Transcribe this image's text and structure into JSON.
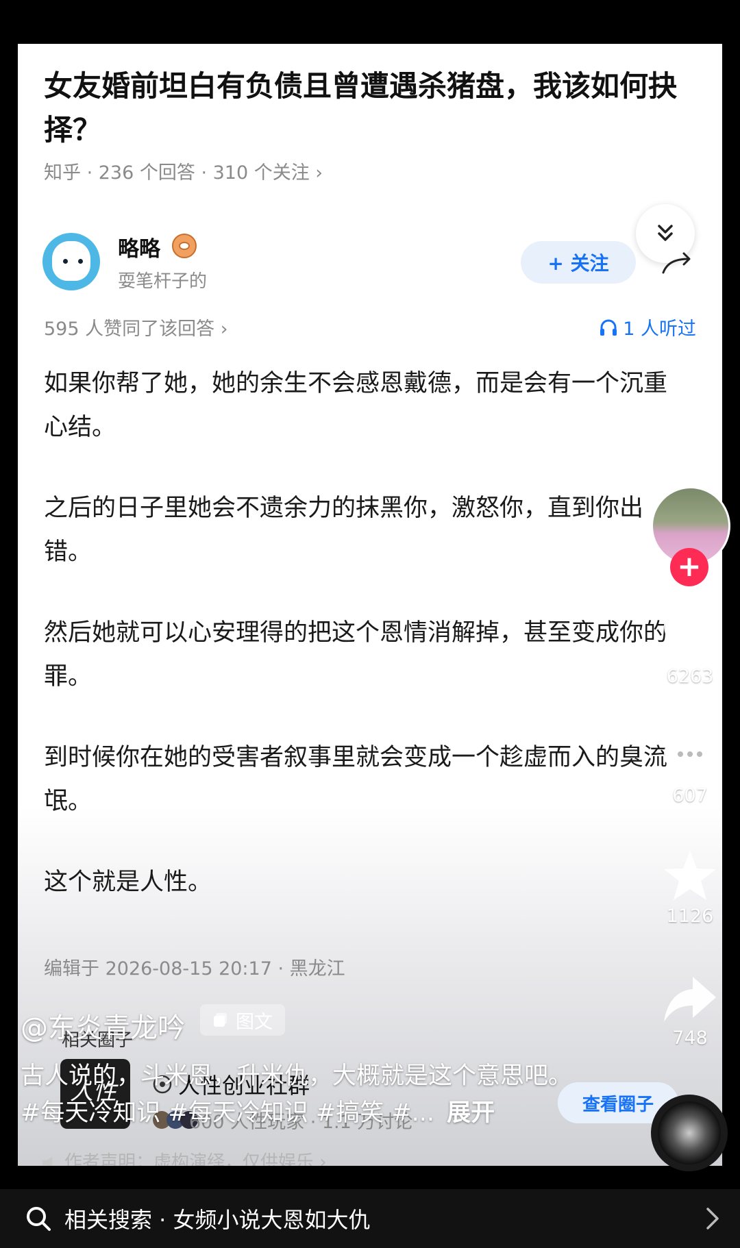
{
  "question": {
    "title": "女友婚前坦白有负债且曾遭遇杀猪盘，我该如何抉择？",
    "meta": "知乎 · 236 个回答 · 310 个关注 ›"
  },
  "author": {
    "name": "略略",
    "subtitle": "耍笔杆子的",
    "follow_label": "+ 关注"
  },
  "stats": {
    "votes": "595 人赞同了该回答 ›",
    "listened": "1 人听过"
  },
  "answer": {
    "paragraphs": [
      "如果你帮了她，她的余生不会感恩戴德，而是会有一个沉重心结。",
      "之后的日子里她会不遗余力的抹黑你，激怒你，直到你出错。",
      "然后她就可以心安理得的把这个恩情消解掉，甚至变成你的罪。",
      "到时候你在她的受害者叙事里就会变成一个趁虚而入的臭流氓。",
      "这个就是人性。"
    ],
    "edited": "编辑于 2026-08-15 20:17 · 黑龙江"
  },
  "related_circle": {
    "heading": "相关圈子",
    "name": "人性创业社群",
    "stats": "600 人性玩家 · 1.1 万讨论",
    "view_label": "查看圈子",
    "thumb_text": "人性"
  },
  "disclaimer": "作者声明：虚构演绎，仅供娱乐 ›",
  "overlay": {
    "author": "@东炎青龙吟",
    "tag": "图文",
    "caption": "古人说的，斗米恩，升米仇，大概就是这个意思吧。#每天冷知识 #每天冷知识 #搞笑 #...",
    "expand": "展开"
  },
  "rail": {
    "likes": "6263",
    "comments": "607",
    "favorites": "1126",
    "shares": "748"
  },
  "bottom_bar": {
    "text": "相关搜索 · 女频小说大恩如大仇"
  }
}
